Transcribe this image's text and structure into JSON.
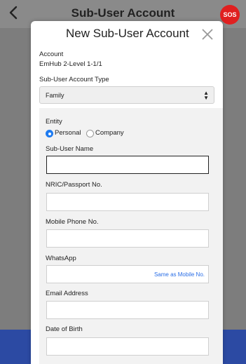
{
  "header": {
    "title": "Sub-User Account",
    "back_icon": "chevron-left-icon",
    "sos_label": "SOS",
    "sos_color": "#e02020"
  },
  "colors": {
    "backdrop": "#777777",
    "bottom_bar": "#2c4aa3",
    "link": "#2a6ee6",
    "radio_accent": "#1e7bf0"
  },
  "modal": {
    "title": "New Sub-User Account",
    "close_icon": "close-icon",
    "account_label": "Account",
    "account_value": "EmHub 2-Level 1-1/1",
    "type_label": "Sub-User Account Type",
    "type_value": "Family",
    "entity_label": "Entity",
    "entity_options": [
      "Personal",
      "Company"
    ],
    "entity_selected": "Personal",
    "fields": {
      "name_label": "Sub-User Name",
      "nric_label": "NRIC/Passport No.",
      "mobile_label": "Mobile Phone No.",
      "whatsapp_label": "WhatsApp",
      "whatsapp_link": "Same as Mobile No.",
      "email_label": "Email Address",
      "dob_label": "Date of Birth"
    }
  }
}
